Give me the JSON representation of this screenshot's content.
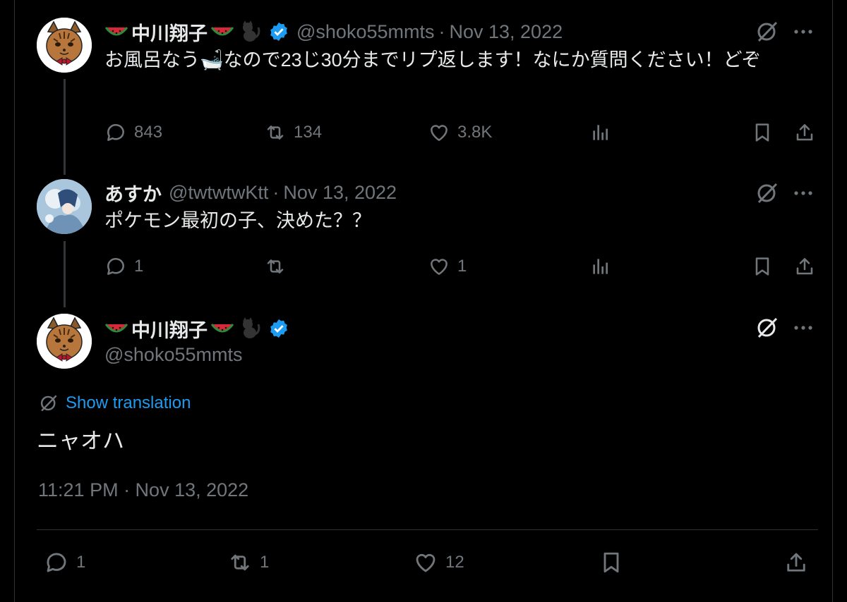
{
  "colors": {
    "background": "#000000",
    "text": "#e7e9ea",
    "muted": "#71767b",
    "link": "#1d9bf0",
    "verified": "#1d9bf0",
    "divider": "#2f3336"
  },
  "tweet1": {
    "author_name": "中川翔子",
    "handle": "@shoko55mmts",
    "separator": "·",
    "date": "Nov 13, 2022",
    "text": "お風呂なう🛁なので23じ30分までリプ返します！なにか質問ください！どぞ",
    "replies": "843",
    "retweets": "134",
    "likes": "3.8K"
  },
  "tweet2": {
    "author_name": "あすか",
    "handle": "@twtwtwKtt",
    "separator": "·",
    "date": "Nov 13, 2022",
    "text": "ポケモン最初の子、決めた？？",
    "replies": "1",
    "retweets": "",
    "likes": "1"
  },
  "main_tweet": {
    "author_name": "中川翔子",
    "handle": "@shoko55mmts",
    "translate_label": "Show translation",
    "text": "ニャオハ",
    "timestamp": "11:21 PM · Nov 13, 2022",
    "replies": "1",
    "retweets": "1",
    "likes": "12"
  },
  "icons": [
    "watermelon-icon",
    "black-cat-icon",
    "verified-badge-icon",
    "grok-icon",
    "more-icon",
    "reply-icon",
    "retweet-icon",
    "like-icon",
    "views-icon",
    "bookmark-icon",
    "share-icon",
    "translate-icon"
  ]
}
